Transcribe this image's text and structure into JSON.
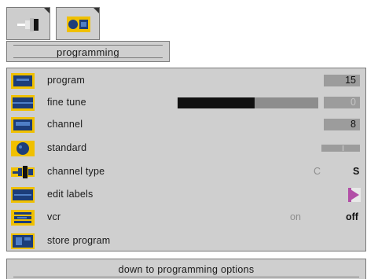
{
  "tabs": [
    {
      "icon": "connector-icon",
      "active": false
    },
    {
      "icon": "tv-settings-icon",
      "active": true
    }
  ],
  "page_title": "programming",
  "menu": {
    "program": {
      "label": "program",
      "value": "15",
      "icon": "program-icon"
    },
    "fine_tune": {
      "label": "fine tune",
      "value": "0",
      "level_fraction": 0.55,
      "icon": "fine-tune-icon"
    },
    "channel": {
      "label": "channel",
      "value": "8",
      "icon": "channel-icon"
    },
    "standard": {
      "label": "standard",
      "icon": "standard-icon"
    },
    "channel_type": {
      "label": "channel type",
      "option_a": "C",
      "option_b": "S",
      "selected": "S",
      "icon": "channel-type-icon"
    },
    "edit_labels": {
      "label": "edit labels",
      "icon": "edit-labels-icon",
      "action_icon": "arrow-right-icon"
    },
    "vcr": {
      "label": "vcr",
      "option_a": "on",
      "option_b": "off",
      "selected": "off",
      "icon": "vcr-icon"
    },
    "store_program": {
      "label": "store program",
      "icon": "store-program-icon"
    }
  },
  "footer": {
    "hint": "down to programming options"
  },
  "colors": {
    "panel": "#cfcfcf",
    "icon_yellow": "#f0c000",
    "icon_blue": "#1c3d7a",
    "accent_magenta": "#b24fa7"
  }
}
